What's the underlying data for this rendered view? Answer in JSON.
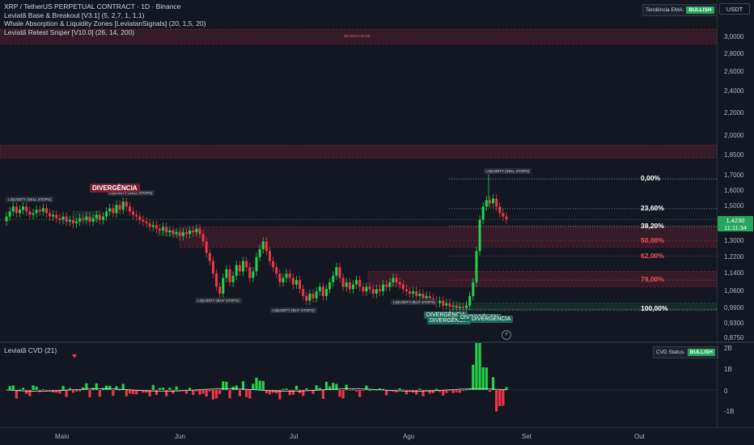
{
  "legend": {
    "symbol": "XRP / TetherUS PERPETUAL CONTRACT · 1D · Binance",
    "ind1": "Leviatã Base & Breakout [V3.1] (5, 2,7, 1, 1,1)",
    "ind2": "Whale Absorption & Liquidity Zones [LeviatanSignals] (20, 1,5, 20)",
    "ind3": "Leviatã Retest Sniper [V10.0] (26, 14, 200)"
  },
  "ema_status": {
    "label": "Tendência EMA:",
    "value": "BULLISH"
  },
  "currency": "USDT",
  "price_scale": [
    "3,0000",
    "2,8000",
    "2,6000",
    "2,4000",
    "2,2000",
    "2,0000",
    "1,8500",
    "1,7000",
    "1,6000",
    "1,5000",
    "1,4000",
    "1,3000",
    "1,2200",
    "1,1400",
    "1,0600",
    "0,9900",
    "0,9300",
    "0,8750"
  ],
  "current_price": {
    "price": "1,4230",
    "countdown": "11:11:34"
  },
  "fib_levels": [
    {
      "label": "0,00%",
      "price": 1.68,
      "color": "#ffffff"
    },
    {
      "label": "23,60%",
      "price": 1.487,
      "color": "#ffffff"
    },
    {
      "label": "38,20%",
      "price": 1.383,
      "color": "#ffffff"
    },
    {
      "label": "50,00%",
      "price": 1.303,
      "color": "#f7525f"
    },
    {
      "label": "62,00%",
      "price": 1.224,
      "color": "#f7525f"
    },
    {
      "label": "79,00%",
      "price": 1.11,
      "color": "#f7525f"
    },
    {
      "label": "100,00%",
      "price": 0.985,
      "color": "#ffffff"
    }
  ],
  "annotations": {
    "bearish_base": "BEARISH BASE",
    "liq_sell_1": "LIQUIDITY (SELL STOPS)",
    "liq_sell_2": "LIQUIDITY (SELL STOPS)",
    "liq_sell_3": "LIQUIDITY (SELL STOPS)",
    "divergence_top": "DIVERGÊNCIA",
    "liq_buy_1": "LIQUIDITY (BUY STOPS)",
    "liq_buy_2": "LIQUIDITY (BUY STOPS)",
    "liq_buy_3": "LIQUIDITY (BUY STOPS)",
    "liq_buy_4": "LIQUIDITY (BUY STOPS)",
    "div_a": "DIVERGÊNCIA",
    "div_b": "DIVERGÊNCIA",
    "div_c": "DIVERGÊNCIA",
    "div_d": "DIVERGÊNCIA"
  },
  "cvd": {
    "title": "Leviatã CVD (21)",
    "status_label": "CVD Status:",
    "status_value": "BULLISH",
    "scale": [
      "2B",
      "1B",
      "0",
      "-1B"
    ]
  },
  "time_axis": [
    "Maio",
    "Jun",
    "Jul",
    "Ago",
    "Set",
    "Out"
  ],
  "colors": {
    "bg": "#131722",
    "up": "#26d14a",
    "down": "#f23645",
    "bullish": "#26a65b"
  },
  "chart_data": {
    "type": "candlestick",
    "scale": "log",
    "ylim": [
      0.85,
      3.1
    ],
    "closes": [
      1.44,
      1.47,
      1.5,
      1.46,
      1.48,
      1.5,
      1.47,
      1.45,
      1.46,
      1.48,
      1.47,
      1.49,
      1.46,
      1.44,
      1.45,
      1.43,
      1.42,
      1.44,
      1.41,
      1.42,
      1.4,
      1.41,
      1.43,
      1.42,
      1.44,
      1.41,
      1.43,
      1.45,
      1.42,
      1.44,
      1.47,
      1.49,
      1.46,
      1.51,
      1.48,
      1.53,
      1.5,
      1.47,
      1.45,
      1.44,
      1.42,
      1.41,
      1.4,
      1.38,
      1.39,
      1.37,
      1.36,
      1.38,
      1.35,
      1.36,
      1.34,
      1.35,
      1.33,
      1.35,
      1.34,
      1.36,
      1.35,
      1.37,
      1.34,
      1.3,
      1.24,
      1.2,
      1.14,
      1.08,
      1.05,
      1.12,
      1.16,
      1.1,
      1.13,
      1.18,
      1.15,
      1.2,
      1.17,
      1.12,
      1.15,
      1.22,
      1.26,
      1.3,
      1.25,
      1.2,
      1.17,
      1.14,
      1.1,
      1.12,
      1.14,
      1.12,
      1.09,
      1.11,
      1.07,
      1.04,
      1.02,
      1.05,
      1.03,
      1.06,
      1.08,
      1.04,
      1.07,
      1.1,
      1.13,
      1.17,
      1.12,
      1.08,
      1.1,
      1.07,
      1.09,
      1.11,
      1.08,
      1.06,
      1.08,
      1.07,
      1.05,
      1.07,
      1.06,
      1.09,
      1.08,
      1.1,
      1.12,
      1.1,
      1.09,
      1.07,
      1.06,
      1.05,
      1.06,
      1.04,
      1.05,
      1.03,
      1.04,
      1.03,
      1.02,
      1.01,
      1.02,
      1.0,
      1.01,
      0.995,
      1.0,
      0.99,
      0.995,
      0.99,
      1.0,
      1.04,
      1.1,
      1.25,
      1.42,
      1.5,
      1.54,
      1.52,
      1.55,
      1.5,
      1.46,
      1.44,
      1.423
    ]
  }
}
